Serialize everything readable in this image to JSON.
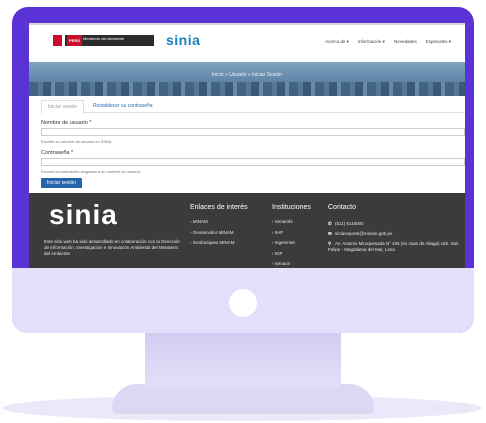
{
  "header": {
    "gov_badge": "PERÚ",
    "ministry": "Ministerio del Ambiente",
    "brand": "sinia",
    "nav": [
      "Acerca de ▾",
      "Información ▾",
      "Novedades",
      "Especiales ▾"
    ]
  },
  "hero": {
    "breadcrumb": "Inicio » Usuario » Iniciar Sesión"
  },
  "tabs": [
    "Iniciar sesión",
    "Restablecer su contraseña"
  ],
  "form": {
    "username_label": "Nombre de usuario *",
    "username_value": "",
    "username_help": "Escriba su nombre de usuario en SINIA.",
    "password_label": "Contraseña *",
    "password_value": "",
    "password_help": "Escriba la contraseña asignada a su nombre de usuario.",
    "submit_label": "Iniciar sesión"
  },
  "footer": {
    "logo": "sinia",
    "description": "Este sitio web ha sido desarrollado en colaboración con la Dirección de Información, Investigación e Innovación Ambiental del Ministerio del Ambiente",
    "links_title": "Enlaces de interés",
    "links": [
      "MINAM",
      "Geoservidor MINAM",
      "Geobosques MINAM"
    ],
    "institutions_title": "Instituciones",
    "institutions": [
      "Senamhi",
      "IIAP",
      "Ingemmet",
      "IGP",
      "Senace"
    ],
    "contact_title": "Contacto",
    "phone": "(511) 6116000",
    "email": "siniasoporte@minam.gob.pe",
    "address": "Av. Antonio Miroquesada N° 425 (ex Juan de Aliaga) Urb. San Felipe - Magdalena del Mar, Lima"
  },
  "colors": {
    "monitor_frame": "#5b32d6",
    "brand_blue": "#1a7fbf",
    "button_blue": "#2763a8",
    "footer_bg": "#3b3b3b"
  }
}
